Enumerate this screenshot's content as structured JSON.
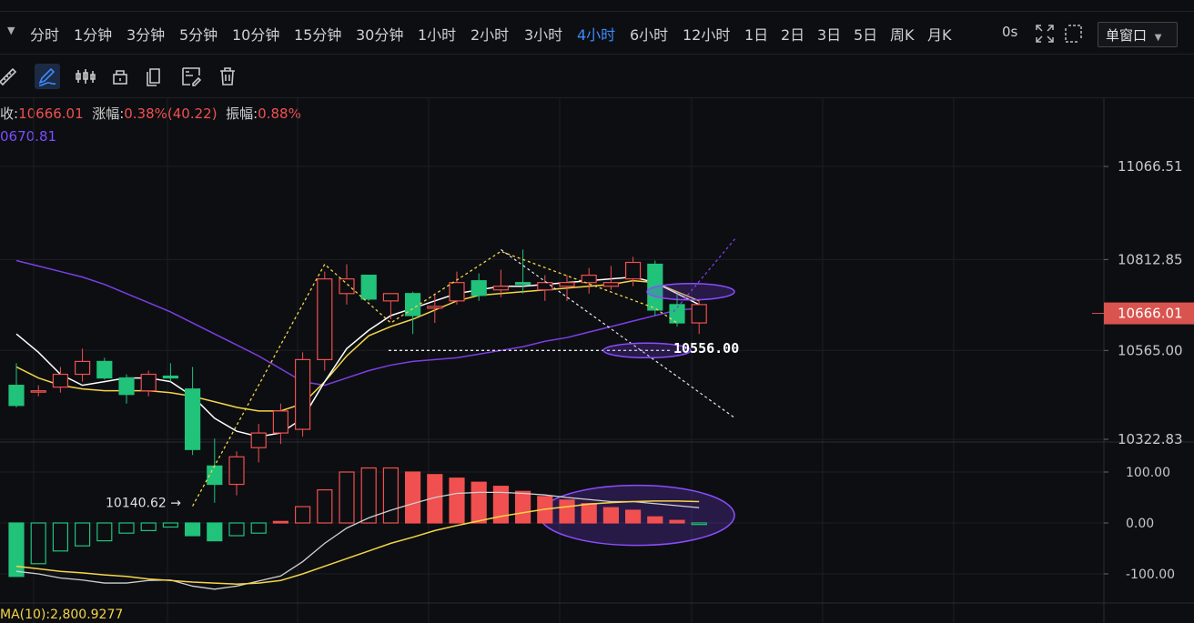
{
  "timeframes": [
    "分时",
    "1分钟",
    "3分钟",
    "5分钟",
    "10分钟",
    "15分钟",
    "30分钟",
    "1小时",
    "2小时",
    "3小时",
    "4小时",
    "6小时",
    "12小时",
    "1日",
    "2日",
    "3日",
    "5日",
    "周K",
    "月K"
  ],
  "active_timeframe": "4小时",
  "speed_label": "0s",
  "window_mode": "单窗口",
  "info": {
    "close_label": "收:",
    "close_value": "10666.01",
    "change_label": "涨幅:",
    "change_value": "0.38%(40.22)",
    "amplitude_label": "振幅:",
    "amplitude_value": "0.88%",
    "ma_value": "0670.81"
  },
  "macd_label": "MA(10):2,800.9277",
  "colors": {
    "up": "#f0504f",
    "down": "#21c27a",
    "accent": "#3d8bff",
    "ma_purple": "#7b3fe4",
    "ma_yellow": "#f5d546",
    "ma_white": "#ffffff"
  },
  "chart_data": {
    "type": "candlestick",
    "price_axis": {
      "ticks": [
        {
          "value": 11066.51,
          "label": "11066.51"
        },
        {
          "value": 10812.85,
          "label": "10812.85"
        },
        {
          "value": 10565.0,
          "label": "10565.00"
        },
        {
          "value": 10322.83,
          "label": "10322.83"
        }
      ],
      "current_price": {
        "value": 10666.01,
        "label": "10666.01"
      }
    },
    "annotations": [
      {
        "text": "10140.62 →",
        "value": 10140.62,
        "bar": 8
      },
      {
        "text": "10556.00",
        "value": 10556.0,
        "bar": 30
      }
    ],
    "candles": [
      {
        "o": 10470,
        "h": 10530,
        "l": 10410,
        "c": 10415
      },
      {
        "o": 10455,
        "h": 10470,
        "l": 10440,
        "c": 10455
      },
      {
        "o": 10465,
        "h": 10520,
        "l": 10450,
        "c": 10500
      },
      {
        "o": 10500,
        "h": 10570,
        "l": 10480,
        "c": 10535
      },
      {
        "o": 10535,
        "h": 10545,
        "l": 10485,
        "c": 10490
      },
      {
        "o": 10490,
        "h": 10500,
        "l": 10420,
        "c": 10445
      },
      {
        "o": 10455,
        "h": 10510,
        "l": 10440,
        "c": 10500
      },
      {
        "o": 10495,
        "h": 10530,
        "l": 10480,
        "c": 10490
      },
      {
        "o": 10460,
        "h": 10520,
        "l": 10280,
        "c": 10295
      },
      {
        "o": 10250,
        "h": 10325,
        "l": 10150,
        "c": 10200
      },
      {
        "o": 10200,
        "h": 10290,
        "l": 10170,
        "c": 10275
      },
      {
        "o": 10300,
        "h": 10365,
        "l": 10260,
        "c": 10340
      },
      {
        "o": 10340,
        "h": 10420,
        "l": 10310,
        "c": 10400
      },
      {
        "o": 10350,
        "h": 10560,
        "l": 10330,
        "c": 10540
      },
      {
        "o": 10540,
        "h": 10780,
        "l": 10510,
        "c": 10760
      },
      {
        "o": 10720,
        "h": 10800,
        "l": 10690,
        "c": 10760
      },
      {
        "o": 10770,
        "h": 10770,
        "l": 10700,
        "c": 10705
      },
      {
        "o": 10700,
        "h": 10720,
        "l": 10650,
        "c": 10720
      },
      {
        "o": 10720,
        "h": 10725,
        "l": 10610,
        "c": 10660
      },
      {
        "o": 10680,
        "h": 10720,
        "l": 10640,
        "c": 10685
      },
      {
        "o": 10700,
        "h": 10780,
        "l": 10690,
        "c": 10750
      },
      {
        "o": 10755,
        "h": 10775,
        "l": 10700,
        "c": 10715
      },
      {
        "o": 10730,
        "h": 10785,
        "l": 10710,
        "c": 10740
      },
      {
        "o": 10750,
        "h": 10840,
        "l": 10720,
        "c": 10745
      },
      {
        "o": 10730,
        "h": 10770,
        "l": 10700,
        "c": 10750
      },
      {
        "o": 10740,
        "h": 10770,
        "l": 10700,
        "c": 10750
      },
      {
        "o": 10750,
        "h": 10790,
        "l": 10720,
        "c": 10770
      },
      {
        "o": 10740,
        "h": 10795,
        "l": 10730,
        "c": 10750
      },
      {
        "o": 10760,
        "h": 10820,
        "l": 10740,
        "c": 10805
      },
      {
        "o": 10800,
        "h": 10810,
        "l": 10660,
        "c": 10675
      },
      {
        "o": 10690,
        "h": 10720,
        "l": 10630,
        "c": 10640
      },
      {
        "o": 10640,
        "h": 10705,
        "l": 10610,
        "c": 10690
      }
    ],
    "ma_purple": [
      10810,
      10795,
      10780,
      10765,
      10745,
      10720,
      10695,
      10670,
      10640,
      10610,
      10580,
      10550,
      10515,
      10480,
      10470,
      10490,
      10510,
      10525,
      10535,
      10540,
      10545,
      10555,
      10565,
      10575,
      10590,
      10600,
      10615,
      10630,
      10645,
      10660,
      10675,
      10680
    ],
    "ma_yellow": [
      10520,
      10490,
      10470,
      10460,
      10455,
      10455,
      10455,
      10450,
      10440,
      10425,
      10410,
      10400,
      10400,
      10420,
      10480,
      10550,
      10605,
      10630,
      10650,
      10675,
      10700,
      10715,
      10720,
      10725,
      10730,
      10735,
      10740,
      10745,
      10755,
      10750,
      10725,
      10700
    ],
    "ma_white": [
      10610,
      10560,
      10500,
      10470,
      10480,
      10490,
      10490,
      10480,
      10440,
      10380,
      10345,
      10330,
      10340,
      10380,
      10480,
      10570,
      10620,
      10660,
      10680,
      10700,
      10720,
      10730,
      10740,
      10740,
      10745,
      10750,
      10755,
      10760,
      10765,
      10750,
      10720,
      10690
    ],
    "macd_axis": {
      "ticks": [
        {
          "value": 100,
          "label": "100.00"
        },
        {
          "value": 0,
          "label": "0.00"
        },
        {
          "value": -100,
          "label": "-100.00"
        }
      ]
    },
    "macd_hist": [
      -105,
      -80,
      -55,
      -45,
      -35,
      -20,
      -15,
      -8,
      -25,
      -35,
      -25,
      -20,
      3,
      32,
      65,
      100,
      108,
      108,
      100,
      95,
      88,
      80,
      72,
      62,
      52,
      45,
      38,
      30,
      25,
      12,
      5,
      -3
    ],
    "macd_dif": [
      -95,
      -100,
      -108,
      -112,
      -118,
      -118,
      -113,
      -112,
      -124,
      -130,
      -124,
      -114,
      -104,
      -76,
      -40,
      -10,
      10,
      25,
      38,
      50,
      58,
      60,
      60,
      58,
      55,
      50,
      46,
      42,
      42,
      38,
      34,
      30
    ],
    "macd_dea": [
      -85,
      -90,
      -95,
      -98,
      -102,
      -105,
      -110,
      -113,
      -116,
      -118,
      -120,
      -118,
      -113,
      -100,
      -85,
      -70,
      -55,
      -40,
      -28,
      -15,
      -5,
      4,
      13,
      20,
      27,
      32,
      37,
      40,
      42,
      43,
      43,
      42
    ]
  }
}
